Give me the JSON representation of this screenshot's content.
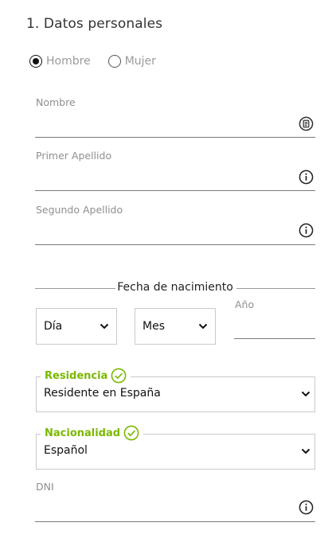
{
  "section": {
    "title": "1. Datos personales"
  },
  "gender": {
    "options": [
      {
        "label": "Hombre",
        "checked": true
      },
      {
        "label": "Mujer",
        "checked": false
      }
    ]
  },
  "fields": {
    "nombre": {
      "label": "Nombre",
      "value": "",
      "icon": "contact-card-icon"
    },
    "primer_apellido": {
      "label": "Primer Apellido",
      "value": "",
      "icon": "info-icon"
    },
    "segundo_apellido": {
      "label": "Segundo Apellido",
      "value": "",
      "icon": "info-icon"
    }
  },
  "birthdate": {
    "legend": "Fecha de nacimiento",
    "day": {
      "selected": "Día"
    },
    "month": {
      "selected": "Mes"
    },
    "year": {
      "label": "Año",
      "value": ""
    }
  },
  "residencia": {
    "label": "Residencia",
    "selected": "Residente en España",
    "valid": true
  },
  "nacionalidad": {
    "label": "Nacionalidad",
    "selected": "Español",
    "valid": true
  },
  "dni": {
    "label": "DNI",
    "value": "",
    "icon": "info-icon"
  },
  "colors": {
    "valid_green": "#7ab800",
    "underline": "#7a7a7a",
    "label_gray": "#8f8f8f"
  }
}
